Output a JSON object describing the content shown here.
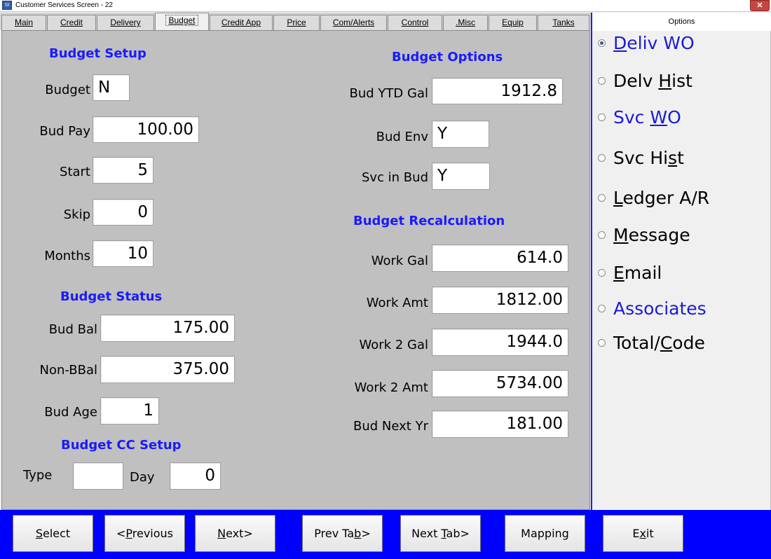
{
  "window": {
    "title": "Customer Services Screen - 22",
    "close": "✕"
  },
  "tabs": [
    {
      "label": "Main"
    },
    {
      "label": "Credit"
    },
    {
      "label": "Delivery"
    },
    {
      "label": "Budget"
    },
    {
      "label": "Credit App"
    },
    {
      "label": "Price"
    },
    {
      "label": "Com/Alerts"
    },
    {
      "label": "Control"
    },
    {
      "label": ".Misc"
    },
    {
      "label": "Equip"
    },
    {
      "label": "Tanks"
    }
  ],
  "active_tab": "Budget",
  "budget_setup": {
    "title": "Budget Setup",
    "budget_label": "Budget",
    "budget_value": "N",
    "bud_pay_label": "Bud Pay",
    "bud_pay_value": "100.00",
    "start_label": "Start",
    "start_value": "5",
    "skip_label": "Skip",
    "skip_value": "0",
    "months_label": "Months",
    "months_value": "10"
  },
  "budget_status": {
    "title": "Budget Status",
    "bud_bal_label": "Bud Bal",
    "bud_bal_value": "175.00",
    "non_bbal_label": "Non-BBal",
    "non_bbal_value": "375.00",
    "bud_age_label": "Bud Age",
    "bud_age_value": "1"
  },
  "budget_cc_setup": {
    "title": "Budget CC Setup",
    "type_label": "Type",
    "type_value": "",
    "day_label": "Day",
    "day_value": "0"
  },
  "budget_options": {
    "title": "Budget Options",
    "bud_ytd_gal_label": "Bud YTD Gal",
    "bud_ytd_gal_value": "1912.8",
    "bud_env_label": "Bud Env",
    "bud_env_value": "Y",
    "svc_in_bud_label": "Svc in Bud",
    "svc_in_bud_value": "Y"
  },
  "budget_recalculation": {
    "title": "Budget Recalculation",
    "work_gal_label": "Work Gal",
    "work_gal_value": "614.0",
    "work_amt_label": "Work Amt",
    "work_amt_value": "1812.00",
    "work2_gal_label": "Work 2 Gal",
    "work2_gal_value": "1944.0",
    "work2_amt_label": "Work 2 Amt",
    "work2_amt_value": "5734.00",
    "bud_next_yr_label": "Bud Next Yr",
    "bud_next_yr_value": "181.00"
  },
  "options": {
    "header": "Options",
    "items": [
      {
        "pre": "",
        "u": "D",
        "post": "eliv WO",
        "checked": true,
        "color": "blue"
      },
      {
        "pre": "Delv ",
        "u": "H",
        "post": "ist",
        "checked": false,
        "color": "black"
      },
      {
        "pre": "Svc ",
        "u": "W",
        "post": "O",
        "checked": false,
        "color": "blue"
      },
      {
        "pre": "Svc Hi",
        "u": "s",
        "post": "t",
        "checked": false,
        "color": "black"
      },
      {
        "pre": "",
        "u": "L",
        "post": "edger A/R",
        "checked": false,
        "color": "black"
      },
      {
        "pre": "",
        "u": "M",
        "post": "essage",
        "checked": false,
        "color": "black"
      },
      {
        "pre": "",
        "u": "E",
        "post": "mail",
        "checked": false,
        "color": "black"
      },
      {
        "pre": "Associates",
        "u": "",
        "post": "",
        "checked": false,
        "color": "blue"
      },
      {
        "pre": "Total/",
        "u": "C",
        "post": "ode",
        "checked": false,
        "color": "black"
      }
    ]
  },
  "buttons": [
    {
      "pre": "",
      "u": "S",
      "post": "elect"
    },
    {
      "pre": "<",
      "u": "P",
      "post": "revious"
    },
    {
      "pre": "",
      "u": "N",
      "post": "ext>"
    },
    {
      "pre": "Prev Ta",
      "u": "b",
      "post": ">"
    },
    {
      "pre": "Next ",
      "u": "T",
      "post": "ab>"
    },
    {
      "pre": "Mapping",
      "u": "",
      "post": ""
    },
    {
      "pre": "E",
      "u": "x",
      "post": "it"
    }
  ],
  "colors": {
    "section_title": "#1a1aff",
    "button_bar": "#0000ff",
    "panel": "#c0c0c0",
    "option_blue": "#1a1ad6"
  }
}
